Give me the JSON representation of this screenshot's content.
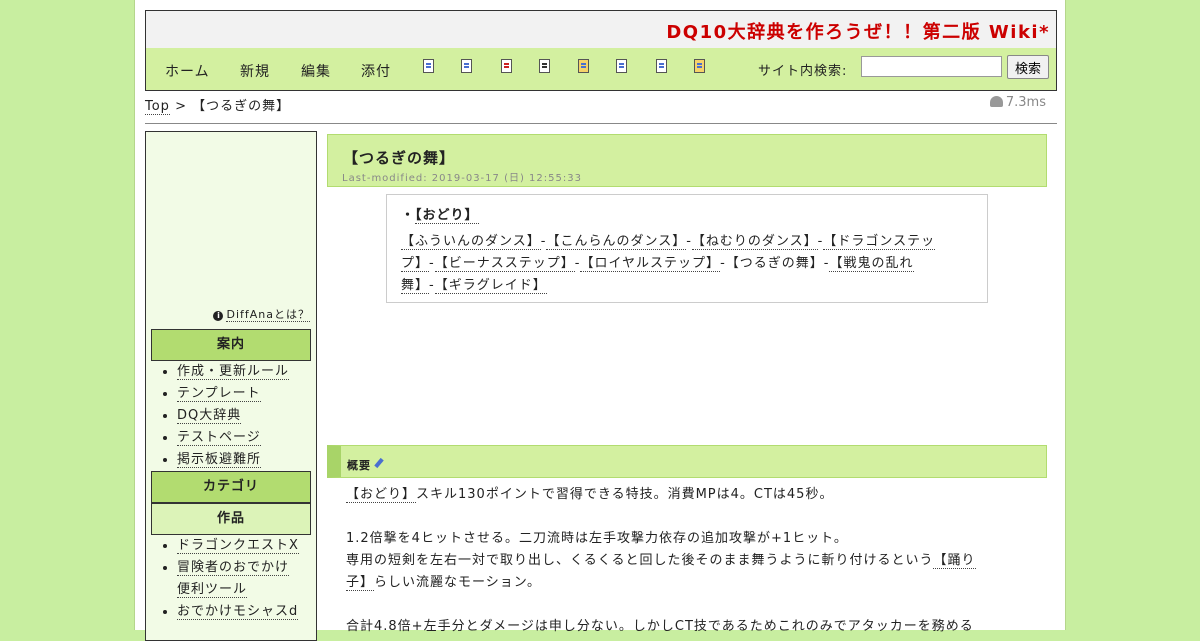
{
  "header": {
    "site_title": "DQ10大辞典を作ろうぜ！！第二版 Wiki*"
  },
  "nav": {
    "home": "ホーム",
    "new": "新規",
    "edit": "編集",
    "attach": "添付",
    "search_label": "サイト内検索:",
    "search_value": "",
    "search_button": "検索",
    "tool_icons": [
      "diff-icon",
      "backup-icon",
      "delete-icon",
      "save-icon",
      "lock-icon",
      "copy-icon",
      "list-icon",
      "help-icon"
    ]
  },
  "breadcrumb": {
    "top": "Top",
    "separator": ">",
    "current": "【つるぎの舞】"
  },
  "timing": "7.3ms",
  "sidebar": {
    "ad_note": "DiffAnaとは？",
    "guide_heading": "案内",
    "guide_items": [
      "作成・更新ルール",
      "テンプレート",
      "DQ大辞典",
      "テストページ",
      "掲示板避難所"
    ],
    "category_heading": "カテゴリ",
    "works_heading": "作品",
    "works_items": [
      "ドラゴンクエストX",
      "冒険者のおでかけ",
      "便利ツール",
      "おでかけモシャスd"
    ]
  },
  "article": {
    "title": "【つるぎの舞】",
    "last_modified": "Last-modified: 2019-03-17 (日) 12:55:33",
    "related": {
      "bullet": "・",
      "title": "【おどり】",
      "links": [
        "【ふういんのダンス】",
        "【こんらんのダンス】",
        "【ねむりのダンス】",
        "【ドラゴンステッ",
        "プ】",
        "【ビーナスステップ】",
        "【ロイヤルステップ】",
        "【つるぎの舞】",
        "【戦鬼の乱れ",
        "舞】",
        "【ギラグレイド】"
      ],
      "separator": "-"
    },
    "section_title": "概要",
    "para1_link": "【おどり】",
    "para1_text": "スキル130ポイントで習得できる特技。消費MPは4。CTは45秒。",
    "para2_line1": "1.2倍撃を4ヒットさせる。二刀流時は左手攻撃力依存の追加攻撃が+1ヒット。",
    "para2_line2_prefix": "専用の短剣を左右一対で取り出し、くるくると回した後そのまま舞うように斬り付けるという",
    "para2_link_a": "【踊り",
    "para2_link_b": "子】",
    "para2_line3_suffix": "らしい流麗なモーション。",
    "para3_line1": "合計4.8倍+左手分とダメージは申し分ない。しかしCT技であるためこれのみでアタッカーを務める"
  }
}
